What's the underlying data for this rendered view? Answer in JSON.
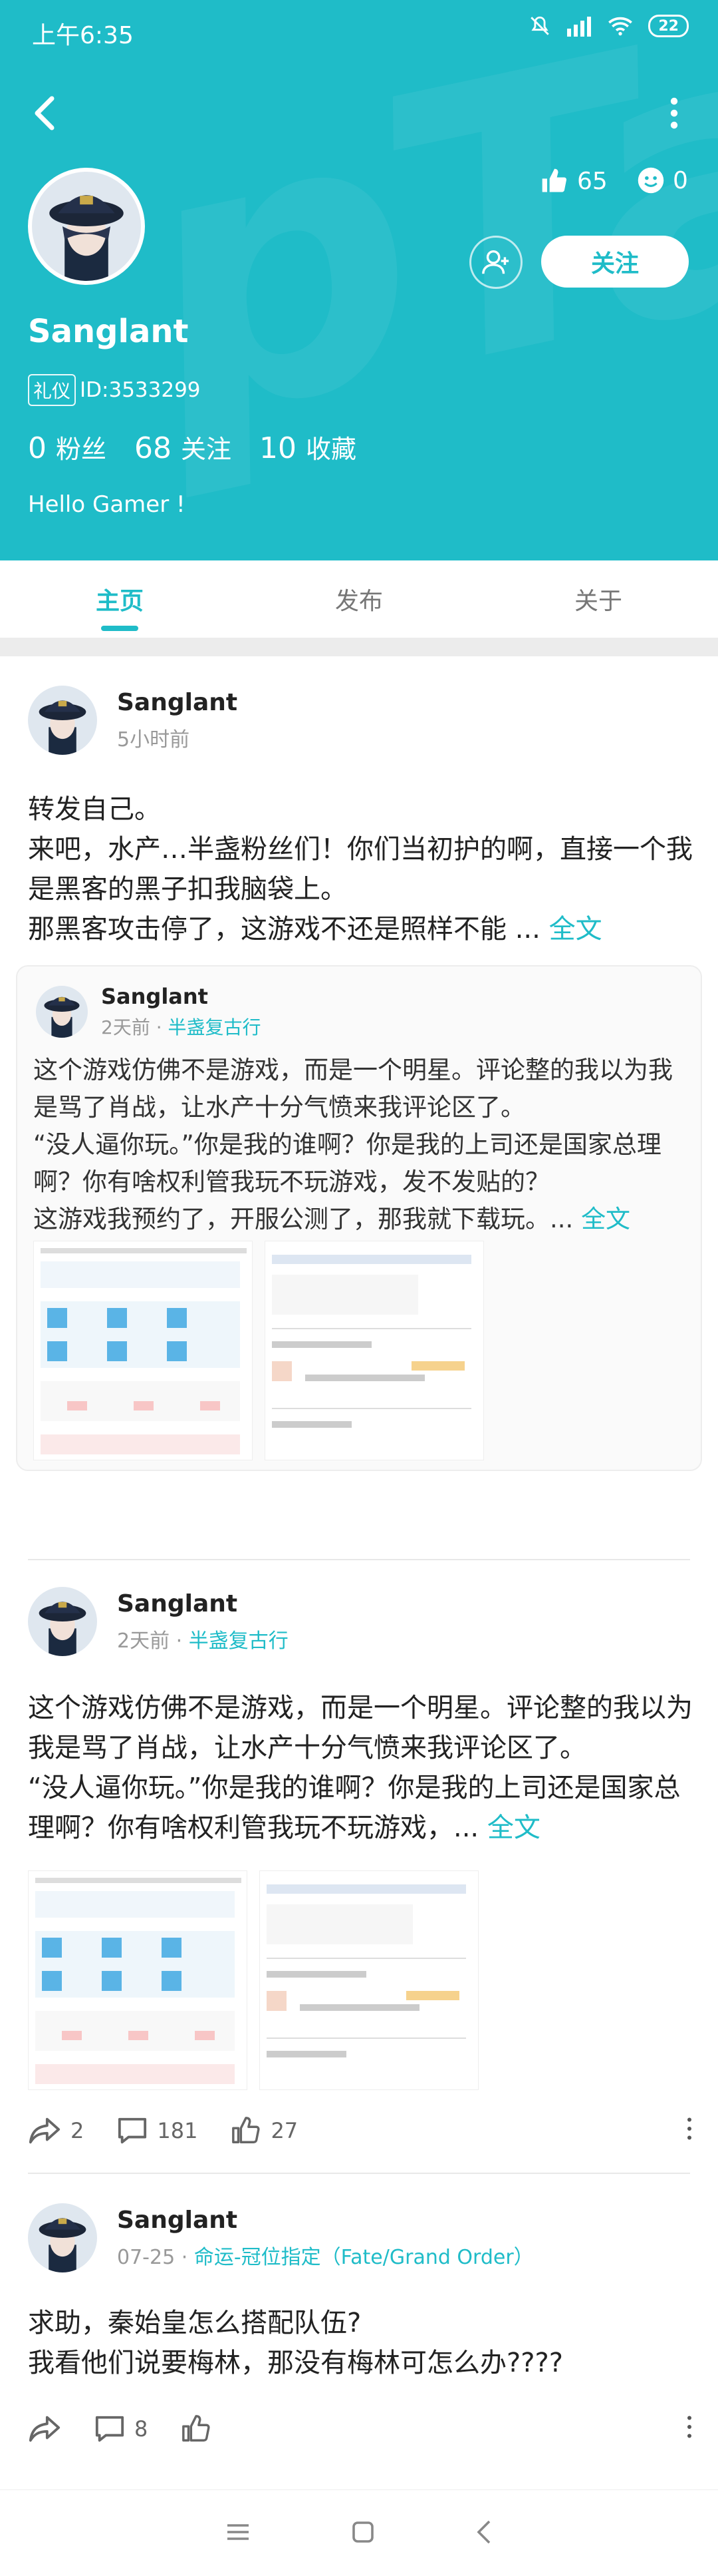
{
  "status_bar": {
    "time": "上午6:35",
    "battery": "22"
  },
  "header": {
    "like_count": "65",
    "smile_count": "0",
    "follow_label": "关注",
    "username": "Sanglant",
    "badge": "礼仪",
    "id_text": "ID:3533299",
    "fans_num": "0",
    "fans_label": "粉丝",
    "follow_num": "68",
    "follow_label2": "关注",
    "collect_num": "10",
    "collect_label": "收藏",
    "bio": "Hello Gamer !"
  },
  "tabs": [
    {
      "label": "主页"
    },
    {
      "label": "发布"
    },
    {
      "label": "关于"
    }
  ],
  "posts": [
    {
      "author": "Sanglant",
      "time": "5小时前",
      "lines": [
        "转发自己。",
        "来吧，水产…半盏粉丝们！你们当初护的啊，直接一个我是黑客的黑子扣我脑袋上。",
        "那黑客攻击停了，这游戏不还是照样不能 ..."
      ],
      "full_text": "全文",
      "repost": {
        "author": "Sanglant",
        "time": "2天前",
        "sep": "·",
        "game": "半盏复古行",
        "lines": [
          "这个游戏仿佛不是游戏，而是一个明星。评论整的我以为我是骂了肖战，让水产十分气愤来我评论区了。",
          "“没人逼你玩。”你是我的谁啊？你是我的上司还是国家总理啊？你有啥权利管我玩不玩游戏，发不发贴的？",
          "这游戏我预约了，开服公测了，那我就下载玩。..."
        ],
        "full_text": "全文"
      }
    },
    {
      "author": "Sanglant",
      "time": "2天前",
      "sep": "·",
      "game": "半盏复古行",
      "lines": [
        "这个游戏仿佛不是游戏，而是一个明星。评论整的我以为我是骂了肖战，让水产十分气愤来我评论区了。",
        "“没人逼你玩。”你是我的谁啊？你是我的上司还是国家总理啊？你有啥权利管我玩不玩游戏，..."
      ],
      "full_text": "全文",
      "shares": "2",
      "comments": "181",
      "likes": "27"
    },
    {
      "author": "Sanglant",
      "time": "07-25",
      "sep": "·",
      "game": "命运-冠位指定（Fate/Grand Order）",
      "lines": [
        "求助，秦始皇怎么搭配队伍?",
        "我看他们说要梅林，那没有梅林可怎么办????"
      ],
      "comments": "8"
    }
  ]
}
